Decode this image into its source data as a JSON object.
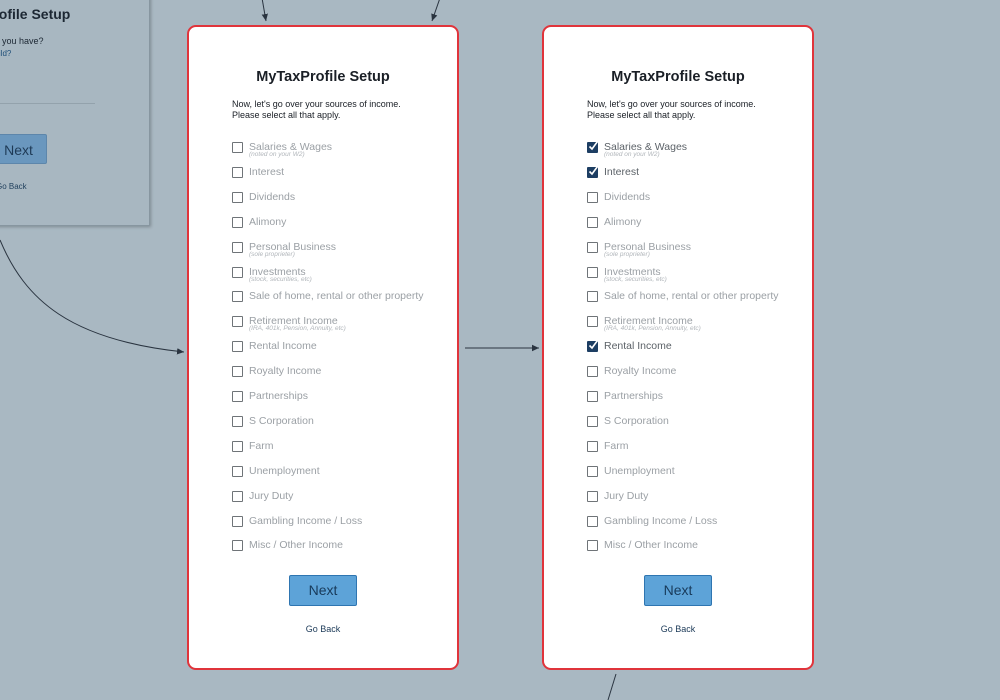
{
  "prev_card": {
    "title": "Profile Setup",
    "question": "n do you have?",
    "link": "a Child?",
    "next_label": "Next",
    "go_back_label": "Go Back"
  },
  "screens": [
    {
      "title": "MyTaxProfile Setup",
      "intro_line1": "Now, let's go over your sources of income.",
      "intro_line2": "Please select all that apply.",
      "options": [
        {
          "label": "Salaries & Wages",
          "sub": "(noted on your W2)",
          "checked": false
        },
        {
          "label": "Interest",
          "checked": false
        },
        {
          "label": "Dividends",
          "checked": false
        },
        {
          "label": "Alimony",
          "checked": false
        },
        {
          "label": "Personal Business",
          "sub": "(sole proprieter)",
          "checked": false
        },
        {
          "label": "Investments",
          "sub": "(stock, securities, etc)",
          "checked": false
        },
        {
          "label": "Sale of home, rental or other property",
          "checked": false
        },
        {
          "label": "Retirement Income",
          "sub": "(IRA, 401k, Pension, Annuity, etc)",
          "checked": false
        },
        {
          "label": "Rental Income",
          "checked": false
        },
        {
          "label": "Royalty Income",
          "checked": false
        },
        {
          "label": "Partnerships",
          "checked": false
        },
        {
          "label": "S Corporation",
          "checked": false
        },
        {
          "label": "Farm",
          "checked": false
        },
        {
          "label": "Unemployment",
          "checked": false
        },
        {
          "label": "Jury Duty",
          "checked": false
        },
        {
          "label": "Gambling Income / Loss",
          "checked": false
        },
        {
          "label": "Misc / Other Income",
          "checked": false
        }
      ],
      "next_label": "Next",
      "go_back_label": "Go Back"
    },
    {
      "title": "MyTaxProfile Setup",
      "intro_line1": "Now, let's go over your sources of income.",
      "intro_line2": "Please select all that apply.",
      "options": [
        {
          "label": "Salaries & Wages",
          "sub": "(noted on your W2)",
          "checked": true
        },
        {
          "label": "Interest",
          "checked": true
        },
        {
          "label": "Dividends",
          "checked": false
        },
        {
          "label": "Alimony",
          "checked": false
        },
        {
          "label": "Personal Business",
          "sub": "(sole proprieter)",
          "checked": false
        },
        {
          "label": "Investments",
          "sub": "(stock, securities, etc)",
          "checked": false
        },
        {
          "label": "Sale of home, rental or other property",
          "checked": false
        },
        {
          "label": "Retirement Income",
          "sub": "(IRA, 401k, Pension, Annuity, etc)",
          "checked": false
        },
        {
          "label": "Rental Income",
          "checked": true
        },
        {
          "label": "Royalty Income",
          "checked": false
        },
        {
          "label": "Partnerships",
          "checked": false
        },
        {
          "label": "S Corporation",
          "checked": false
        },
        {
          "label": "Farm",
          "checked": false
        },
        {
          "label": "Unemployment",
          "checked": false
        },
        {
          "label": "Jury Duty",
          "checked": false
        },
        {
          "label": "Gambling Income / Loss",
          "checked": false
        },
        {
          "label": "Misc / Other Income",
          "checked": false
        }
      ],
      "next_label": "Next",
      "go_back_label": "Go Back"
    }
  ],
  "colors": {
    "canvas": "#a9b8c2",
    "screen_border": "#e0343b",
    "next_button": "#5da3d8",
    "checkbox_checked": "#1d3e63"
  }
}
